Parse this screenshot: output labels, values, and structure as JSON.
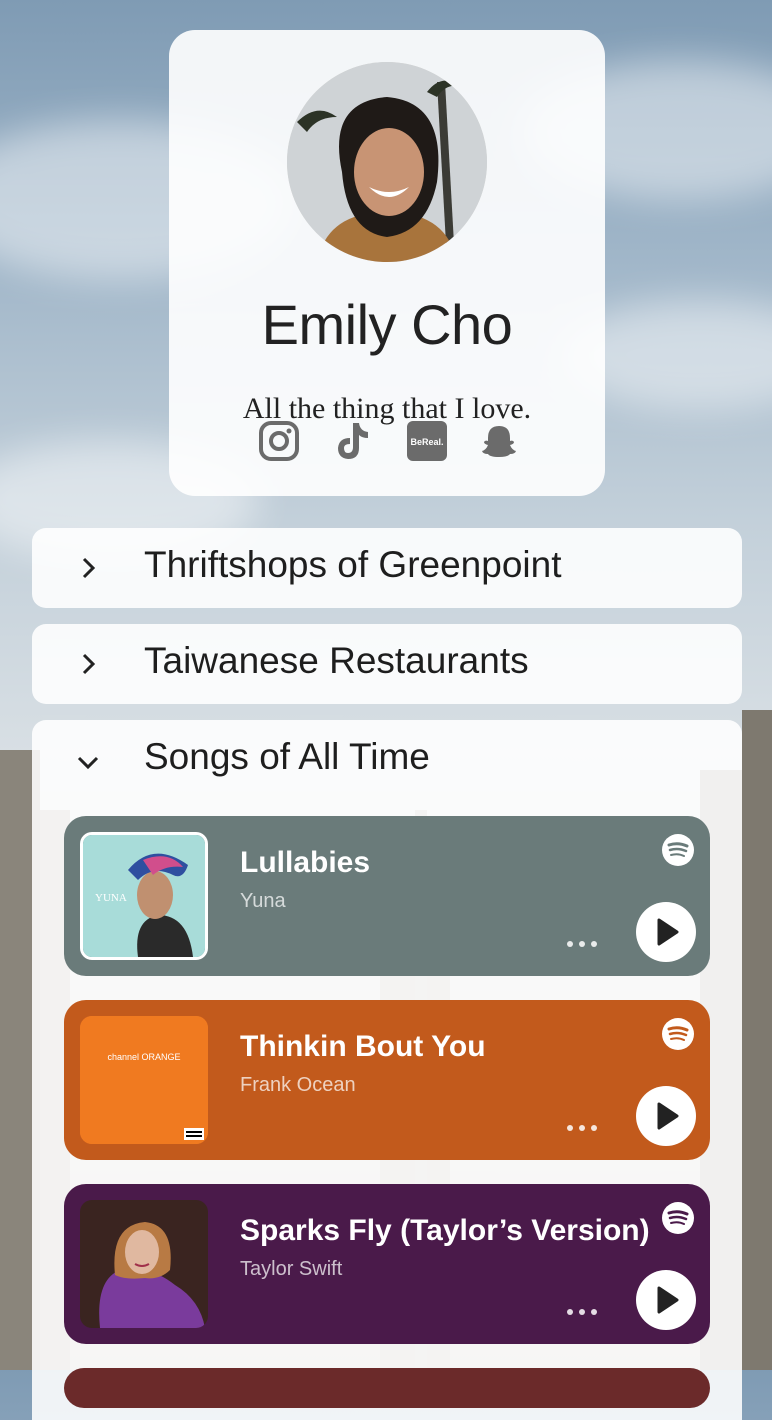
{
  "profile": {
    "name": "Emily Cho",
    "bio": "All the thing that I love.",
    "socials": [
      {
        "icon": "instagram-icon"
      },
      {
        "icon": "tiktok-icon"
      },
      {
        "icon": "bereal-icon",
        "label": "BeReal."
      },
      {
        "icon": "snapchat-icon"
      }
    ]
  },
  "sections": [
    {
      "title": "Thriftshops of Greenpoint",
      "expanded": false
    },
    {
      "title": "Taiwanese Restaurants",
      "expanded": false
    },
    {
      "title": "Songs of All Time",
      "expanded": true
    }
  ],
  "songs": [
    {
      "title": "Lullabies",
      "artist": "Yuna",
      "bg": "#6a7b7a",
      "art_text": "YUNA"
    },
    {
      "title": "Thinkin Bout You",
      "artist": "Frank Ocean",
      "bg": "#c25a1c",
      "art_text": "channel ORANGE"
    },
    {
      "title": "Sparks Fly (Taylor’s Version)",
      "artist": "Taylor Swift",
      "bg": "#4a1a4a"
    }
  ],
  "colors": {
    "play_icon": "#222222",
    "text_dark": "#1e1e1e"
  }
}
